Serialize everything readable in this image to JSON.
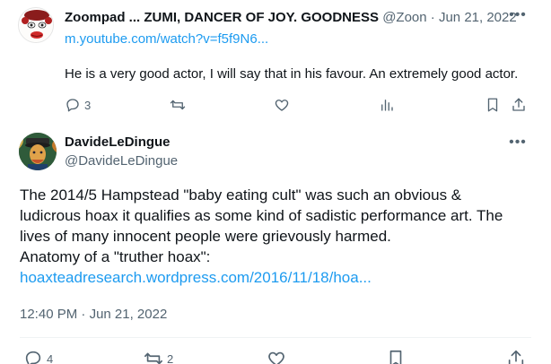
{
  "tweet1": {
    "display_name": "Zoompad ... ZUMI, DANCER OF JOY. GOODNESS",
    "handle": "@Zoon",
    "separator": " · ",
    "date": "Jun 21, 2022",
    "more_icon": "more-horizontal-icon",
    "link": "m.youtube.com/watch?v=f5f9N6...",
    "text": "He is a very good actor, I will say that in his favour. An extremely good actor.",
    "actions": {
      "reply_count": "3",
      "retweet_count": "",
      "like_count": "",
      "views_count": ""
    }
  },
  "tweet2": {
    "display_name": "DavideLeDingue",
    "handle": "@DavideLeDingue",
    "text_lines": [
      "The 2014/5 Hampstead \"baby eating cult\" was such an obvious &",
      "ludicrous hoax it qualifies as some kind of sadistic performance art. The",
      "lives of many innocent people were grievously harmed.",
      "Anatomy of a \"truther hoax\":"
    ],
    "link": "hoaxteadresearch.wordpress.com/2016/11/18/hoa...",
    "time": "12:40 PM",
    "separator": " · ",
    "date": "Jun 21, 2022",
    "actions": {
      "reply_count": "4",
      "retweet_count": "2"
    }
  },
  "colors": {
    "text": "#0f1419",
    "secondary": "#536471",
    "link": "#1d9bf0",
    "divider": "#eff3f4"
  }
}
